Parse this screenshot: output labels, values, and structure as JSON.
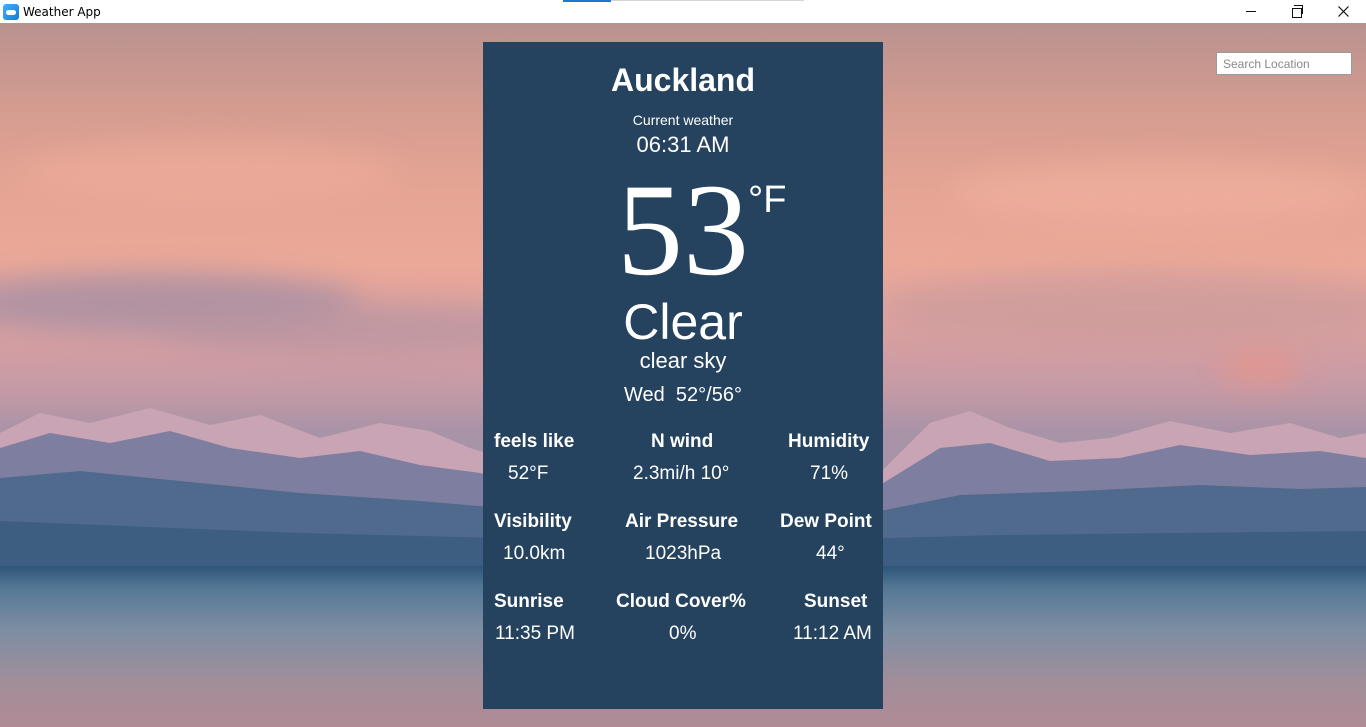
{
  "window": {
    "title": "Weather App"
  },
  "search": {
    "placeholder": "Search Location",
    "value": ""
  },
  "weather": {
    "city": "Auckland",
    "current_label": "Current weather",
    "time": "06:31 AM",
    "temperature": "53",
    "unit": "°F",
    "condition": "Clear",
    "description": "clear sky",
    "day": "Wed",
    "range": "52°/56°"
  },
  "stats": [
    {
      "label": "feels like",
      "value": "52°F"
    },
    {
      "label": "N wind",
      "value": "2.3mi/h 10°"
    },
    {
      "label": "Humidity",
      "value": "71%"
    },
    {
      "label": "Visibility",
      "value": "10.0km"
    },
    {
      "label": "Air Pressure",
      "value": "1023hPa"
    },
    {
      "label": "Dew Point",
      "value": "44°"
    },
    {
      "label": "Sunrise",
      "value": "11:35 PM"
    },
    {
      "label": "Cloud Cover%",
      "value": "0%"
    },
    {
      "label": "Sunset",
      "value": "11:12 AM"
    }
  ],
  "colors": {
    "panel": "#25435e",
    "accent": "#1a78d6"
  }
}
